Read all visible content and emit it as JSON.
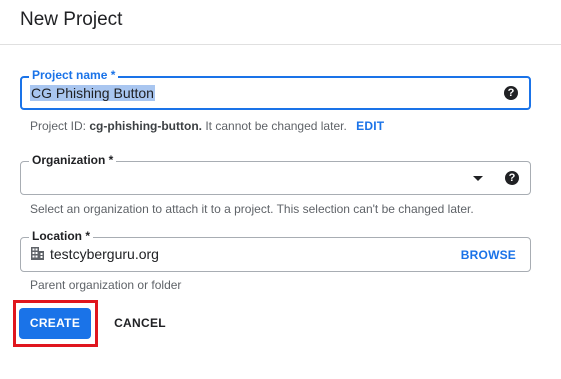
{
  "dialog": {
    "title": "New Project"
  },
  "project_name": {
    "label": "Project name *",
    "value": "CG Phishing Button",
    "help_icon": "help-icon"
  },
  "project_id": {
    "prefix": "Project ID:",
    "id": "cg-phishing-button.",
    "suffix": "It cannot be changed later.",
    "edit_label": "EDIT"
  },
  "organization": {
    "label": "Organization *",
    "value": "",
    "hint": "Select an organization to attach it to a project. This selection can't be changed later.",
    "help_icon": "help-icon",
    "dropdown_icon": "chevron-down-icon"
  },
  "location": {
    "label": "Location *",
    "value": "testcyberguru.org",
    "browse_label": "BROWSE",
    "hint": "Parent organization or folder",
    "icon": "building-icon"
  },
  "actions": {
    "create_label": "CREATE",
    "cancel_label": "CANCEL"
  },
  "colors": {
    "accent": "#1a73e8",
    "highlight": "#e0161e",
    "selection": "#a9c6f0"
  }
}
